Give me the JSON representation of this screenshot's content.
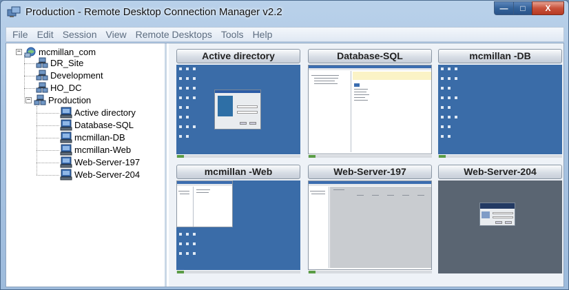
{
  "window": {
    "title": "Production - Remote Desktop Connection Manager v2.2",
    "buttons": {
      "minimize": "—",
      "maximize": "□",
      "close": "X"
    }
  },
  "menu": [
    "File",
    "Edit",
    "Session",
    "View",
    "Remote Desktops",
    "Tools",
    "Help"
  ],
  "tree": {
    "root": "mcmillan_com",
    "groups": [
      "DR_Site",
      "Development",
      "HO_DC",
      "Production"
    ],
    "servers": [
      "Active directory",
      "Database-SQL",
      "mcmillan-DB",
      "mcmillan-Web",
      "Web-Server-197",
      "Web-Server-204"
    ]
  },
  "thumbnails": [
    {
      "label": "Active directory"
    },
    {
      "label": "Database-SQL"
    },
    {
      "label": "mcmillan  -DB"
    },
    {
      "label": "mcmillan  -Web"
    },
    {
      "label": "Web-Server-197"
    },
    {
      "label": "Web-Server-204"
    }
  ],
  "colors": {
    "desktop_blue": "#3a6ca8",
    "desktop_gray": "#5a6572",
    "title_bar": "#b9d1ea",
    "close_button": "#c8513a"
  }
}
